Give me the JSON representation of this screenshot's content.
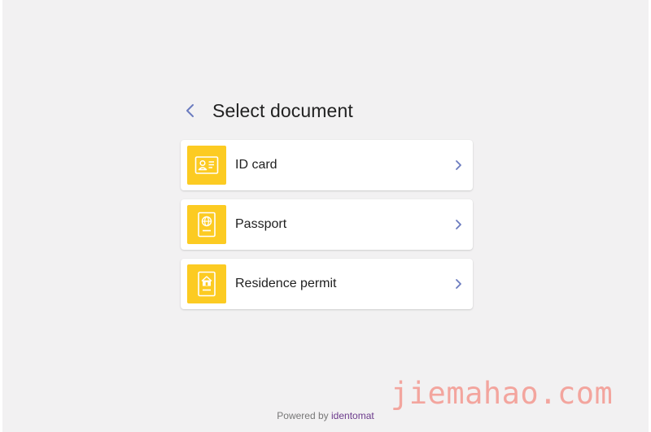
{
  "header": {
    "back_icon": "chevron-left-icon",
    "title": "Select document"
  },
  "documents": [
    {
      "label": "ID card",
      "icon": "id-card-icon"
    },
    {
      "label": "Passport",
      "icon": "passport-icon"
    },
    {
      "label": "Residence permit",
      "icon": "residence-permit-icon"
    }
  ],
  "footer": {
    "powered_by": "Powered by",
    "brand": "identomat"
  },
  "watermark": "jiemahao.com",
  "colors": {
    "background": "#f2f1f2",
    "icon_tile": "#fccb22",
    "accent": "#6b7bbf",
    "brand": "#6c3b8c",
    "watermark": "#f3a59e"
  }
}
